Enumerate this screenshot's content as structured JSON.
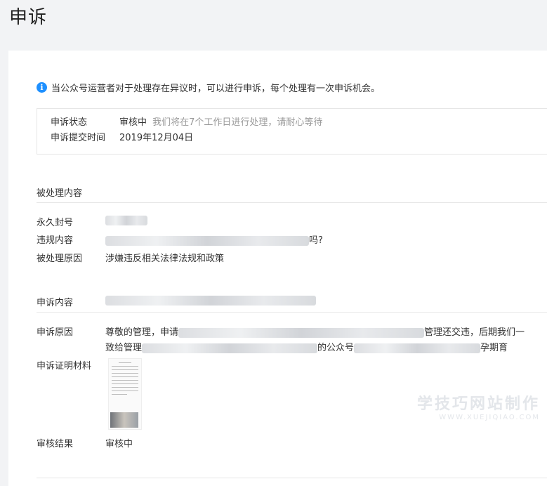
{
  "header": {
    "title": "申诉"
  },
  "notice": {
    "icon": "info-icon",
    "text": "当公众号运营者对于处理存在异议时，可以进行申诉，每个处理有一次申诉机会。"
  },
  "status": {
    "status_label": "申诉状态",
    "status_value": "审核中",
    "status_hint": "我们将在7个工作日进行处理，请耐心等待",
    "time_label": "申诉提交时间",
    "time_value": "2019年12月04日"
  },
  "processed": {
    "title": "被处理内容",
    "ban_label": "永久封号",
    "violation_label": "违规内容",
    "violation_tail": "吗?",
    "reason_label": "被处理原因",
    "reason_value": "涉嫌违反相关法律法规和政策"
  },
  "appeal": {
    "content_label": "申诉内容",
    "reason_label": "申诉原因",
    "reason_line1_start": "尊敬的管理，申请",
    "reason_line1_end": "管理还交违，后期我们一",
    "reason_line2_start": "致给管理",
    "reason_line2_mid": "的公众号",
    "reason_line2_end": "孕期育",
    "evidence_label": "申诉证明材料",
    "result_label": "审核结果",
    "result_value": "审核中"
  },
  "watermark": {
    "text": "学技巧网站制作",
    "sub": "WWW.XUEJIQIAO.COM"
  }
}
